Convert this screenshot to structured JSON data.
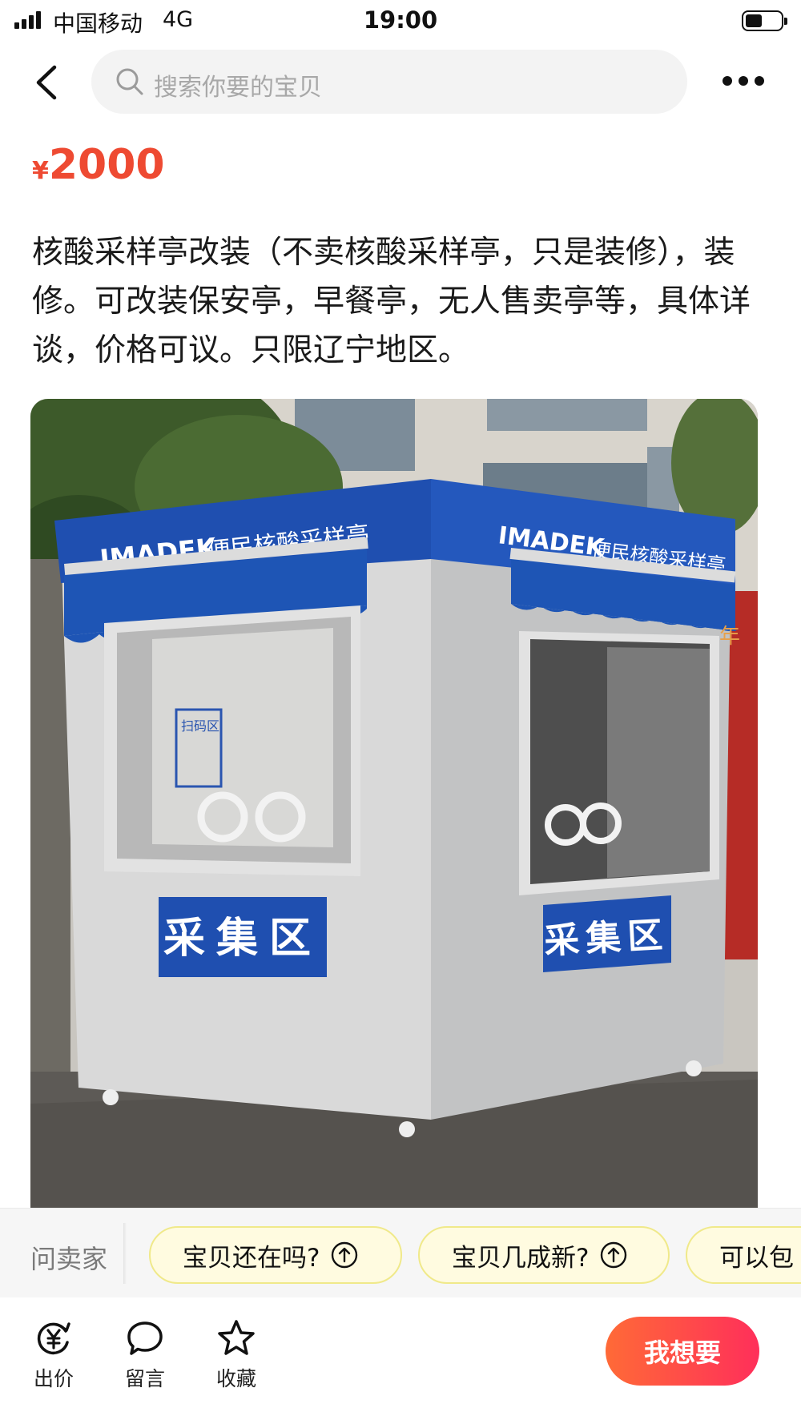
{
  "status_bar": {
    "carrier": "中国移动",
    "network": "4G",
    "time": "19:00"
  },
  "nav": {
    "search_placeholder": "搜索你要的宝贝"
  },
  "listing": {
    "currency": "¥",
    "price": "2000",
    "description": "核酸采样亭改装（不卖核酸采样亭，只是装修），装修。可改装保安亭，早餐亭，无人售卖亭等，具体详谈，价格可议。只限辽宁地区。"
  },
  "photo": {
    "brand": "IMADEK",
    "kiosk_name": "便民核酸采样亭",
    "sign": "采集区",
    "scan_label": "扫码区",
    "year_char": "年"
  },
  "ask_seller": {
    "label": "问卖家",
    "questions": [
      "宝贝还在吗?",
      "宝贝几成新?",
      "可以包"
    ]
  },
  "bottom_bar": {
    "offer_label": "出价",
    "comment_label": "留言",
    "favorite_label": "收藏",
    "want_label": "我想要"
  },
  "colors": {
    "price": "#ee4a32",
    "want_button": "#ff4b45",
    "chip_bg": "#fffbe0",
    "kiosk_blue": "#1f4fb0"
  }
}
